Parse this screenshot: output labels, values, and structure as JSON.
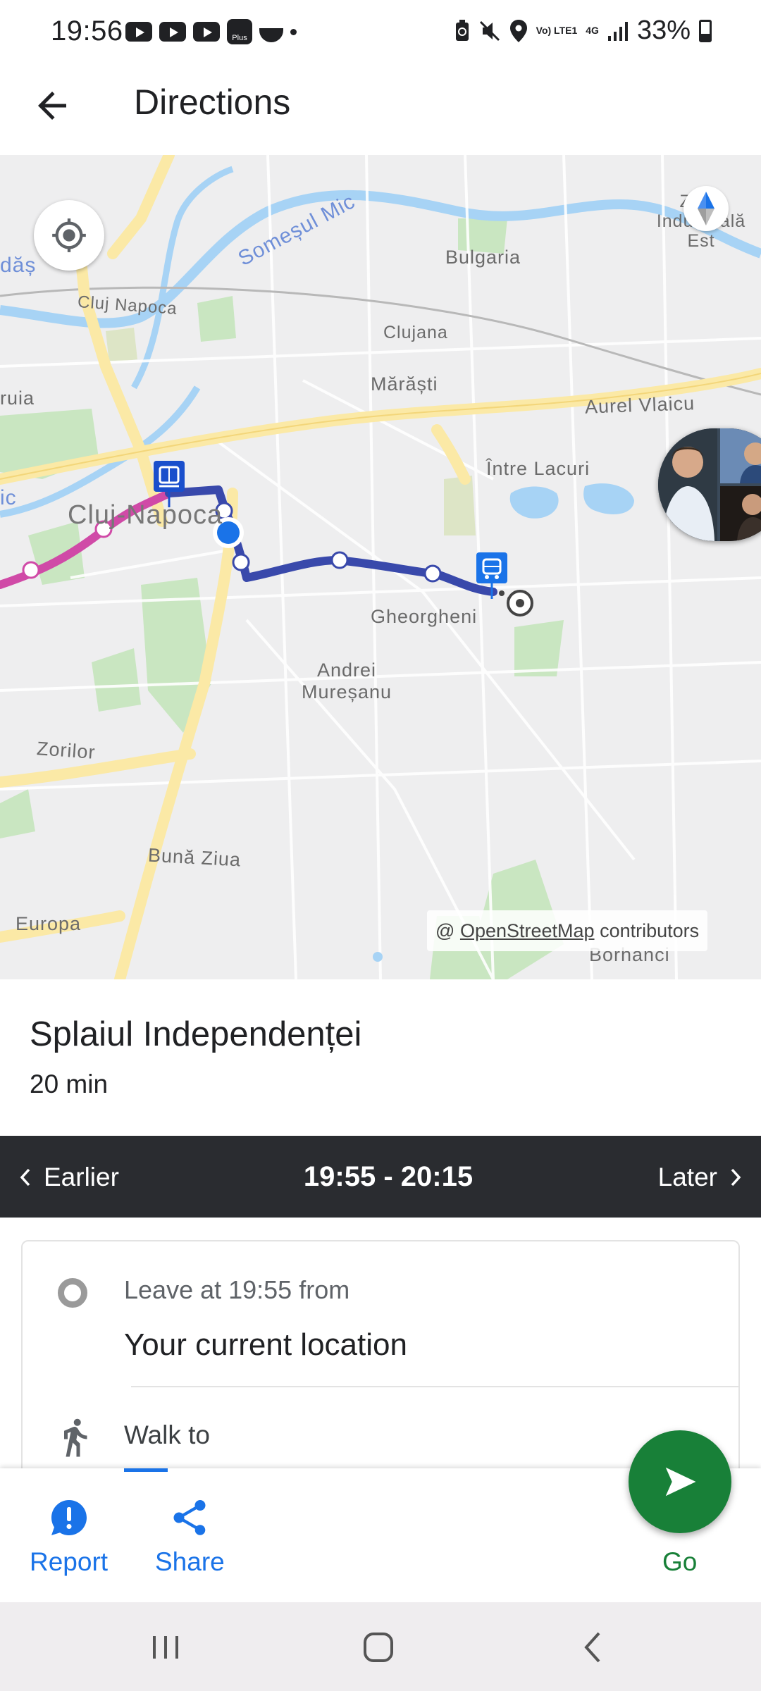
{
  "status_bar": {
    "time": "19:56",
    "battery": "33%",
    "network": "4G",
    "volte": "Vo) LTE1",
    "left_icons": [
      "youtube-icon",
      "youtube-icon",
      "youtube-icon",
      "app-plus-icon",
      "bowl-icon",
      "dot-icon"
    ],
    "right_icons": [
      "battery-saver-icon",
      "mute-icon",
      "location-icon",
      "volte-icon",
      "4g-icon",
      "signal-icon",
      "battery-icon"
    ],
    "app_plus_label": "Plus"
  },
  "app_bar": {
    "title": "Directions",
    "back_icon": "arrow-left-icon"
  },
  "map": {
    "labels": {
      "somesul_mic": "Someșul Mic",
      "bulgaria": "Bulgaria",
      "cluj_napoca_small": "Cluj Napoca",
      "clujana": "Clujana",
      "marasti": "Mărăști",
      "aurel_vlaicu": "Aurel Vlaicu",
      "intre_lacuri": "Între Lacuri",
      "cluj_napoca": "Cluj-Napoca",
      "gheorgheni": "Gheorgheni",
      "andrei_muresanu": "Andrei Mureșanu",
      "zorilor": "Zorilor",
      "buna_ziua": "Bună Ziua",
      "europa": "Europa",
      "bornanci": "Borhanci",
      "ruia": "ruia",
      "dasi": "dăș",
      "ic": "ic",
      "industriala": "Zona Industrială Est"
    },
    "attribution_prefix": "@",
    "attribution_link": "OpenStreetMap",
    "attribution_suffix": "contributors",
    "route_color": "#3949ab",
    "tram_color": "#d04aa7",
    "locate_icon": "my-location-icon",
    "compass_icon": "compass-icon"
  },
  "route": {
    "name": "Splaiul Independenței",
    "duration": "20 min"
  },
  "time_bar": {
    "earlier": "Earlier",
    "range": "19:55 - 20:15",
    "later": "Later"
  },
  "steps": {
    "leave_text": "Leave at 19:55 from",
    "origin": "Your current location",
    "walk_text": "Walk to"
  },
  "actions": {
    "report": "Report",
    "share": "Share",
    "go": "Go"
  },
  "colors": {
    "accent_blue": "#1a73e8",
    "go_green": "#188038",
    "time_bar_bg": "#2a2c30"
  }
}
